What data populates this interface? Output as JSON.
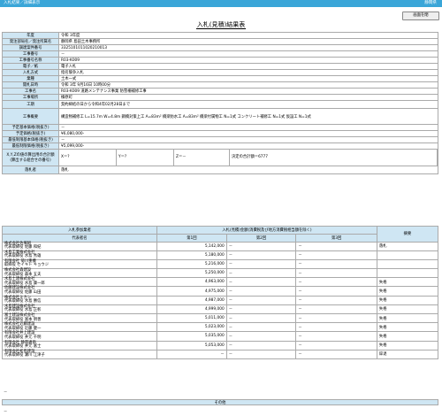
{
  "header": {
    "left": "入札結果／詳細表示",
    "right": "静岡県"
  },
  "close_button": "画面を閉",
  "page_title": "入札(見積)結果表",
  "info_rows": [
    {
      "label": "年度",
      "value": "令和 3年度"
    },
    {
      "label": "発注部局名／発注所属名",
      "value": "静岡県 島田土木事務所"
    },
    {
      "label": "調達案件番号",
      "value": "3325101011020210013"
    },
    {
      "label": "工事番号",
      "value": "－"
    },
    {
      "label": "工事番号名称",
      "value": "R03-K009"
    },
    {
      "label": "電子／紙",
      "value": "電子入札"
    },
    {
      "label": "入札方式",
      "value": "指名競争入札"
    },
    {
      "label": "業種",
      "value": "土木一式"
    },
    {
      "label": "開札日時",
      "value": "令和 3年 9月16日 10時00分"
    },
    {
      "label": "工事名",
      "value": "R03-K009 道路メンテナンス事業 防雪柵補修工事"
    },
    {
      "label": "工事場所",
      "value": "榛原町"
    },
    {
      "label": "工期",
      "value": "契約締結の日から令和4年02月28日まで"
    },
    {
      "label": "工事概要",
      "value": "構造物補修工 L=15.7m W=4.8m 鋼橋対策上工 A=83m² 橋梁防水工 A=83m² 橋梁付属物工 N=1式 コンクリート補修工 N=1式 仮設工 N=1式"
    },
    {
      "label": "予定基本価格(税抜き)",
      "value": "－"
    },
    {
      "label": "予定価格(税抜き)",
      "value": "¥6,080,000-"
    },
    {
      "label": "最低制限基本価格(税抜き)",
      "value": "－"
    },
    {
      "label": "最低制限価格(税抜き)",
      "value": "¥5,099,000-"
    },
    {
      "label": "X,Y,Zの値の算出用の合計額",
      "value": ""
    },
    {
      "label": "落札者",
      "value": "落札"
    }
  ],
  "xyz": {
    "x": "X＝?",
    "y": "Y＝?",
    "z": "Z＝－",
    "note": "決定の合計額＝6777"
  },
  "sub_label": "(算出する組合せの番号)",
  "bid_headers": {
    "company": "入札参加業者",
    "rep": "代表者名",
    "amount": "入札(見積)金額(消費税及び地方消費税相当額を除く)",
    "r1": "第1回",
    "r2": "第2回",
    "r3": "第3回",
    "remark": "摘要"
  },
  "bids": [
    {
      "company": "株式会社佐塚組",
      "rep": "代表取締役 佐藤 和紀",
      "r1": "5,142,000",
      "r2": "－",
      "r3": "－",
      "remark": "落札"
    },
    {
      "company": "水島工業株式会社",
      "rep": "代表取締役 水島 秀雄",
      "r1": "5,180,000",
      "r2": "－",
      "r3": "－",
      "remark": ""
    },
    {
      "company": "有限会社 菊川重機",
      "rep": "取締役 セイキト キョウジ",
      "r1": "5,216,000",
      "r2": "－",
      "r3": "－",
      "remark": ""
    },
    {
      "company": "株式会社森建設",
      "rep": "代表取締役 森本 五夫",
      "r1": "5,250,000",
      "r2": "－",
      "r3": "－",
      "remark": ""
    },
    {
      "company": "水島土建株式会社",
      "rep": "代表取締役 水島 康一郎",
      "r1": "4,963,000",
      "r2": "－",
      "r3": "－",
      "remark": "失格"
    },
    {
      "company": "佐藤建設株式会社",
      "rep": "代表取締役 佐藤 山田",
      "r1": "4,975,000",
      "r2": "－",
      "r3": "－",
      "remark": "失格"
    },
    {
      "company": "株式会社ミカン",
      "rep": "代表取締役 水島 勝信",
      "r1": "4,987,000",
      "r2": "－",
      "r3": "－",
      "remark": "失格"
    },
    {
      "company": "水島建設株式会社",
      "rep": "代表取締役 水島 正彰",
      "r1": "4,999,000",
      "r2": "－",
      "r3": "－",
      "remark": "失格"
    },
    {
      "company": "富士建設株式会社",
      "rep": "代表取締役 富本 明善",
      "r1": "5,011,000",
      "r2": "－",
      "r3": "－",
      "remark": "失格"
    },
    {
      "company": "株式会社近藤建設",
      "rep": "代表取締役 近藤 健一",
      "r1": "5,023,000",
      "r2": "－",
      "r3": "－",
      "remark": "失格"
    },
    {
      "company": "有限会社井上建設",
      "rep": "代表取締役 井元 千明",
      "r1": "5,035,000",
      "r2": "－",
      "r3": "－",
      "remark": "失格"
    },
    {
      "company": "有限会社 静南通商",
      "rep": "代表取締役 井元 富士",
      "r1": "5,053,000",
      "r2": "－",
      "r3": "－",
      "remark": "失格"
    },
    {
      "company": "有限会社松島建設",
      "rep": "代表取締役 瀬川 江津子",
      "r1": "－",
      "r2": "－",
      "r3": "－",
      "remark": "辞退"
    }
  ],
  "sonota_label": "その他",
  "dash": "－"
}
